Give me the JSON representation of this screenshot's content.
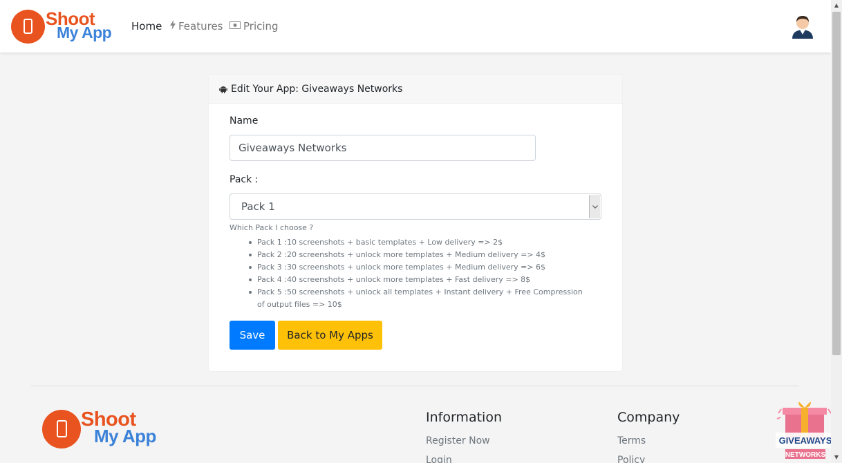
{
  "brand": {
    "word1": "Shoot",
    "word2": "My App"
  },
  "nav": {
    "home": "Home",
    "features": "Features",
    "pricing": "Pricing"
  },
  "icons": {
    "features": "bolt-icon",
    "pricing": "money-icon",
    "header": "android-icon",
    "select": "chevron-down-icon",
    "avatar": "user-avatar"
  },
  "colors": {
    "brand_orange": "#e8531f",
    "brand_blue": "#3b82d9",
    "primary": "#007bff",
    "warning": "#ffc107"
  },
  "card": {
    "header": "Edit Your App: Giveaways Networks",
    "name_label": "Name",
    "name_value": "Giveaways Networks",
    "pack_label": "Pack :",
    "pack_value": "Pack 1",
    "help_text": "Which Pack I choose ?",
    "packs": [
      "Pack 1 :10 screenshots + basic templates + Low delivery => 2$",
      "Pack 2 :20 screenshots + unlock more templates + Medium delivery => 4$",
      "Pack 3 :30 screenshots + unlock more templates + Medium delivery => 6$",
      "Pack 4 :40 screenshots + unlock more templates + Fast delivery => 8$",
      "Pack 5 :50 screenshots + unlock all templates + Instant delivery + Free Compression of output files => 10$"
    ],
    "save": "Save",
    "back": "Back to My Apps"
  },
  "footer": {
    "info_heading": "Information",
    "info_links": [
      "Register Now",
      "Login"
    ],
    "company_heading": "Company",
    "company_links": [
      "Terms",
      "Policy"
    ]
  },
  "badge": {
    "line1": "GIVEAWAYS",
    "line2": "NETWORKS"
  }
}
